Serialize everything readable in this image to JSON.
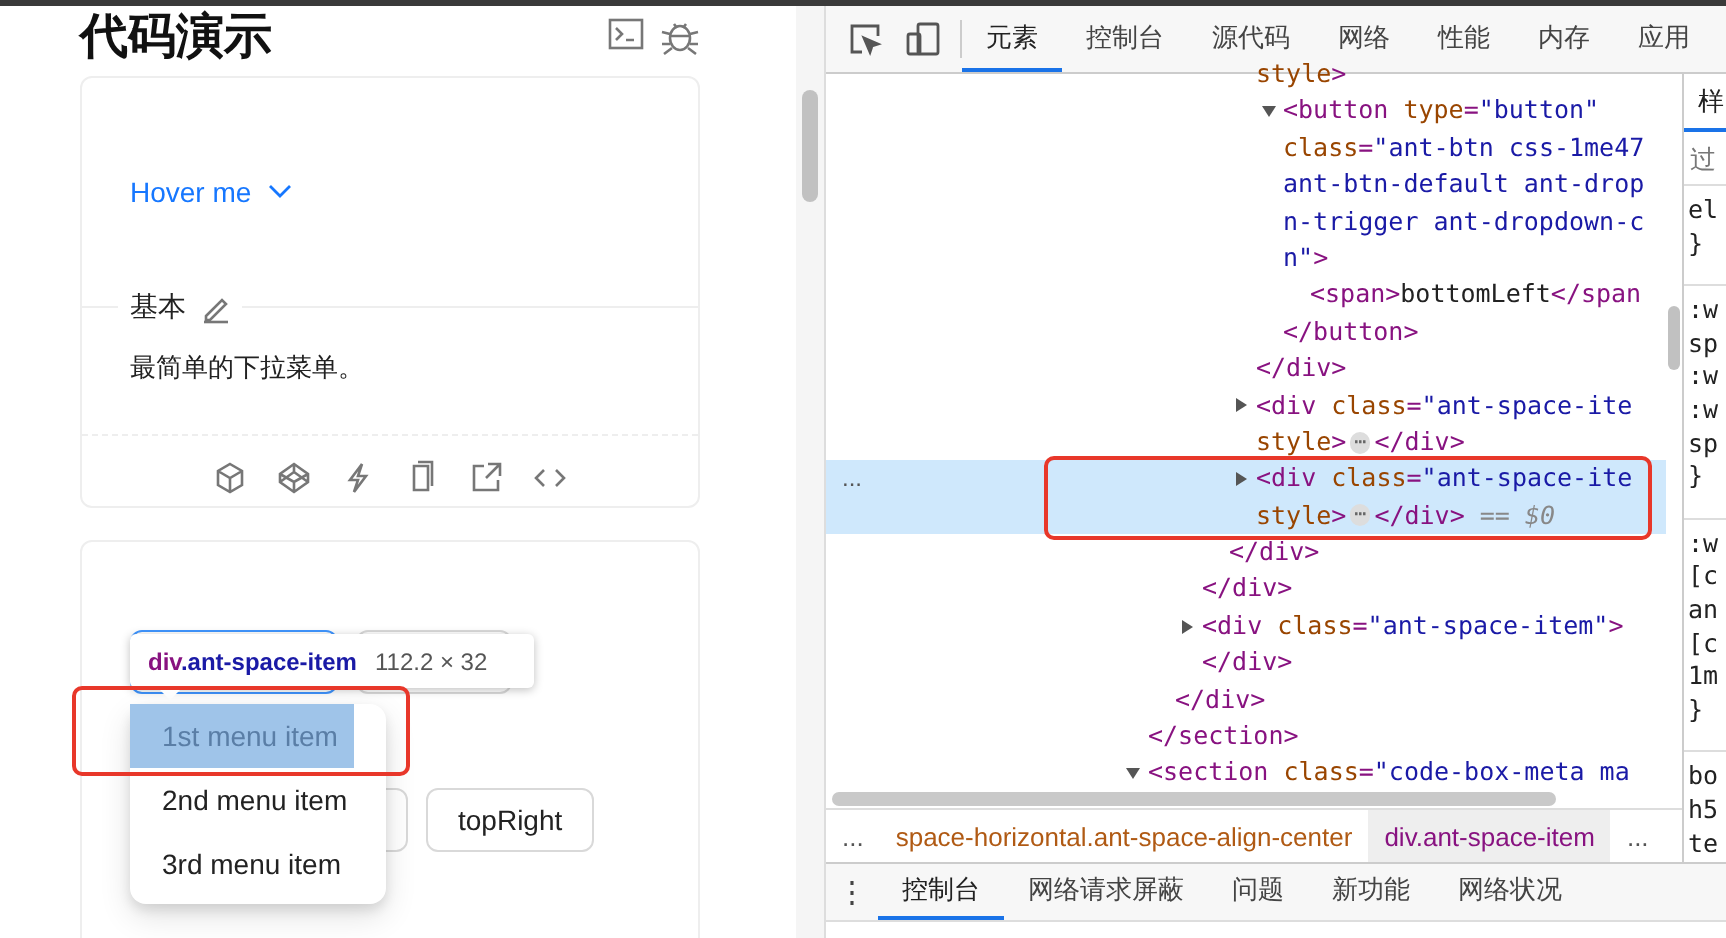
{
  "page": {
    "title": "代码演示",
    "demo_card": {
      "trigger": "Hover me",
      "section_title": "基本",
      "description": "最简单的下拉菜单。"
    },
    "placement_card": {
      "rows": [
        [
          {
            "hovered": true
          },
          {
            "hovered": false
          }
        ],
        [
          {
            "hovered": false
          },
          {
            "label": "topRight",
            "hovered": false
          }
        ]
      ],
      "inspect_tooltip": {
        "tag": "div",
        "classes": ".ant-space-item",
        "size": "112.2 × 32"
      },
      "dropdown_menu": [
        {
          "label": "1st menu item",
          "highlighted": true
        },
        {
          "label": "2nd menu item",
          "highlighted": false
        },
        {
          "label": "3rd menu item",
          "highlighted": false
        }
      ]
    }
  },
  "devtools": {
    "tabs": [
      {
        "label": "元素",
        "selected": true
      },
      {
        "label": "控制台",
        "selected": false
      },
      {
        "label": "源代码",
        "selected": false
      },
      {
        "label": "网络",
        "selected": false
      },
      {
        "label": "性能",
        "selected": false
      },
      {
        "label": "内存",
        "selected": false
      },
      {
        "label": "应用",
        "selected": false
      }
    ],
    "gutter_marker": "...",
    "elements_tree": [
      {
        "selected": false,
        "closing": [
          {
            "kind": "tag",
            "text": "</section>"
          }
        ],
        "children": [
          {
            "selected": false,
            "closing": [
              {
                "kind": "tag",
                "text": "</div>"
              }
            ],
            "children": [
              {
                "selected": false,
                "closing": [
                  {
                    "kind": "tag",
                    "text": "</div>"
                  }
                ],
                "children": [
                  {
                    "selected": false,
                    "closing": [
                      {
                        "kind": "tag",
                        "text": "</div>"
                      }
                    ],
                    "children": [
                      {
                        "selected": false,
                        "lines": [
                          [
                            {
                              "kind": "attr",
                              "text": "style"
                            },
                            {
                              "kind": "tag",
                              "text": ">"
                            }
                          ]
                        ],
                        "closing": [
                          {
                            "kind": "tag",
                            "text": "</div>"
                          }
                        ],
                        "children": [
                          {
                            "expanded": true,
                            "selected": false,
                            "lines": [
                              [
                                {
                                  "kind": "tag",
                                  "text": "<button"
                                },
                                {
                                  "kind": "attr",
                                  "text": " type"
                                },
                                {
                                  "kind": "punct",
                                  "text": "="
                                },
                                {
                                  "kind": "value",
                                  "text": "\"button\""
                                }
                              ],
                              [
                                {
                                  "kind": "attr",
                                  "text": "class"
                                },
                                {
                                  "kind": "punct",
                                  "text": "="
                                },
                                {
                                  "kind": "value",
                                  "text": "\"ant-btn css-1me47"
                                }
                              ],
                              [
                                {
                                  "kind": "value",
                                  "text": "ant-btn-default ant-drop"
                                }
                              ],
                              [
                                {
                                  "kind": "value",
                                  "text": "n-trigger ant-dropdown-c"
                                }
                              ],
                              [
                                {
                                  "kind": "value",
                                  "text": "n\""
                                },
                                {
                                  "kind": "tag",
                                  "text": ">"
                                }
                              ]
                            ],
                            "closing": [
                              {
                                "kind": "tag",
                                "text": "</button>"
                              }
                            ],
                            "children": [
                              {
                                "selected": false,
                                "lines": [
                                  [
                                    {
                                      "kind": "tag",
                                      "text": "<span>"
                                    },
                                    {
                                      "kind": "text",
                                      "text": "bottomLeft"
                                    },
                                    {
                                      "kind": "tag",
                                      "text": "</span"
                                    }
                                  ]
                                ]
                              }
                            ]
                          }
                        ]
                      },
                      {
                        "expanded": false,
                        "selected": false,
                        "lines": [
                          [
                            {
                              "kind": "tag",
                              "text": "<div"
                            },
                            {
                              "kind": "attr",
                              "text": " class"
                            },
                            {
                              "kind": "punct",
                              "text": "="
                            },
                            {
                              "kind": "value",
                              "text": "\"ant-space-ite"
                            }
                          ],
                          [
                            {
                              "kind": "attr",
                              "text": "style"
                            },
                            {
                              "kind": "tag",
                              "text": ">"
                            },
                            {
                              "kind": "badge",
                              "text": "⋯"
                            },
                            {
                              "kind": "tag",
                              "text": "</div>"
                            }
                          ]
                        ]
                      },
                      {
                        "expanded": false,
                        "selected": true,
                        "lines": [
                          [
                            {
                              "kind": "tag",
                              "text": "<div"
                            },
                            {
                              "kind": "attr",
                              "text": " class"
                            },
                            {
                              "kind": "punct",
                              "text": "="
                            },
                            {
                              "kind": "value",
                              "text": "\"ant-space-ite"
                            }
                          ],
                          [
                            {
                              "kind": "attr",
                              "text": "style"
                            },
                            {
                              "kind": "tag",
                              "text": ">"
                            },
                            {
                              "kind": "badge",
                              "text": "⋯"
                            },
                            {
                              "kind": "tag",
                              "text": "</div>"
                            },
                            {
                              "kind": "ref",
                              "text": " == $0"
                            }
                          ]
                        ]
                      }
                    ]
                  }
                ]
              },
              {
                "expanded": false,
                "selected": false,
                "lines": [
                  [
                    {
                      "kind": "tag",
                      "text": "<div"
                    },
                    {
                      "kind": "attr",
                      "text": " class"
                    },
                    {
                      "kind": "punct",
                      "text": "="
                    },
                    {
                      "kind": "value",
                      "text": "\"ant-space-item\""
                    },
                    {
                      "kind": "tag",
                      "text": ">"
                    }
                  ]
                ],
                "closing": [
                  {
                    "kind": "tag",
                    "text": "</div>"
                  }
                ]
              }
            ]
          }
        ]
      },
      {
        "expanded": true,
        "selected": false,
        "lines": [
          [
            {
              "kind": "tag",
              "text": "<section"
            },
            {
              "kind": "attr",
              "text": " class"
            },
            {
              "kind": "punct",
              "text": "="
            },
            {
              "kind": "value",
              "text": "\"code-box-meta ma"
            }
          ]
        ]
      }
    ],
    "styles_pane": {
      "tab": "样",
      "filter_placeholder": "过",
      "blocks": [
        [
          "el",
          "}"
        ],
        [
          ":w",
          "sp",
          ":w",
          ":w",
          "sp",
          "}"
        ],
        [
          ":w",
          "[c",
          "an",
          "[c",
          "1m",
          "}"
        ],
        [
          "bo",
          "h5",
          "te"
        ]
      ]
    },
    "breadcrumbs": [
      {
        "label": "...",
        "selected": false
      },
      {
        "label": "space-horizontal.ant-space-align-center",
        "selected": false
      },
      {
        "label": "div.ant-space-item",
        "selected": true
      },
      {
        "label": "...",
        "selected": false
      }
    ],
    "drawer": {
      "menu": "⋮",
      "tabs": [
        {
          "label": "控制台",
          "selected": true
        },
        {
          "label": "网络请求屏蔽",
          "selected": false
        },
        {
          "label": "问题",
          "selected": false
        },
        {
          "label": "新功能",
          "selected": false
        },
        {
          "label": "网络状况",
          "selected": false
        }
      ]
    }
  }
}
